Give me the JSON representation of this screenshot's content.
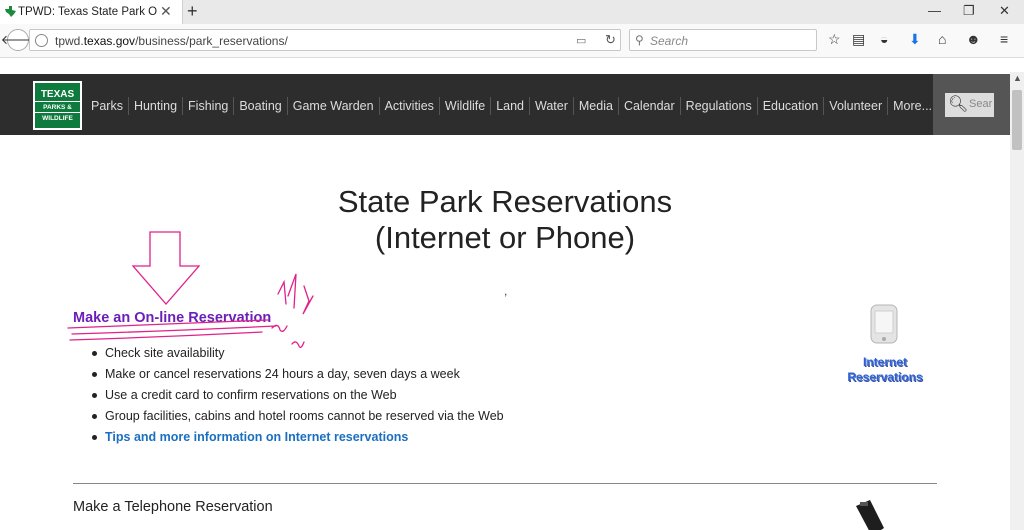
{
  "browser": {
    "tab_title": "TPWD: Texas State Park O...",
    "url_prefix": "tpwd.",
    "url_domain": "texas.gov",
    "url_path": "/business/park_reservations/",
    "search_placeholder": "Search"
  },
  "site": {
    "logo": {
      "line1": "TEXAS",
      "line2": "PARKS &",
      "line3": "WILDLIFE"
    },
    "nav": [
      "Parks",
      "Hunting",
      "Fishing",
      "Boating",
      "Game Warden",
      "Activities",
      "Wildlife",
      "Land",
      "Water",
      "Media",
      "Calendar",
      "Regulations",
      "Education",
      "Volunteer",
      "More..."
    ],
    "search_placeholder": "Sear"
  },
  "page": {
    "title_line1": "State Park Reservations",
    "title_line2": "(Internet or Phone)",
    "comma": ",",
    "online_link": "Make an On-line Reservation",
    "features": [
      "Check site availability",
      "Make or cancel reservations 24 hours a day, seven days a week",
      "Use a credit card to confirm reservations on the Web",
      "Group facilities, cabins and hotel rooms cannot be reserved via the Web"
    ],
    "tips_link": "Tips and more information on Internet reservations",
    "internet_label_line1": "Internet",
    "internet_label_line2": "Reservations",
    "telephone_heading": "Make a Telephone Reservation"
  },
  "colors": {
    "header_bg": "#2d2d2d",
    "logo_green": "#0e7a3d",
    "link_purple": "#6c1fb8",
    "link_blue": "#1a6fc0",
    "annotation_pink": "#e0218a"
  }
}
